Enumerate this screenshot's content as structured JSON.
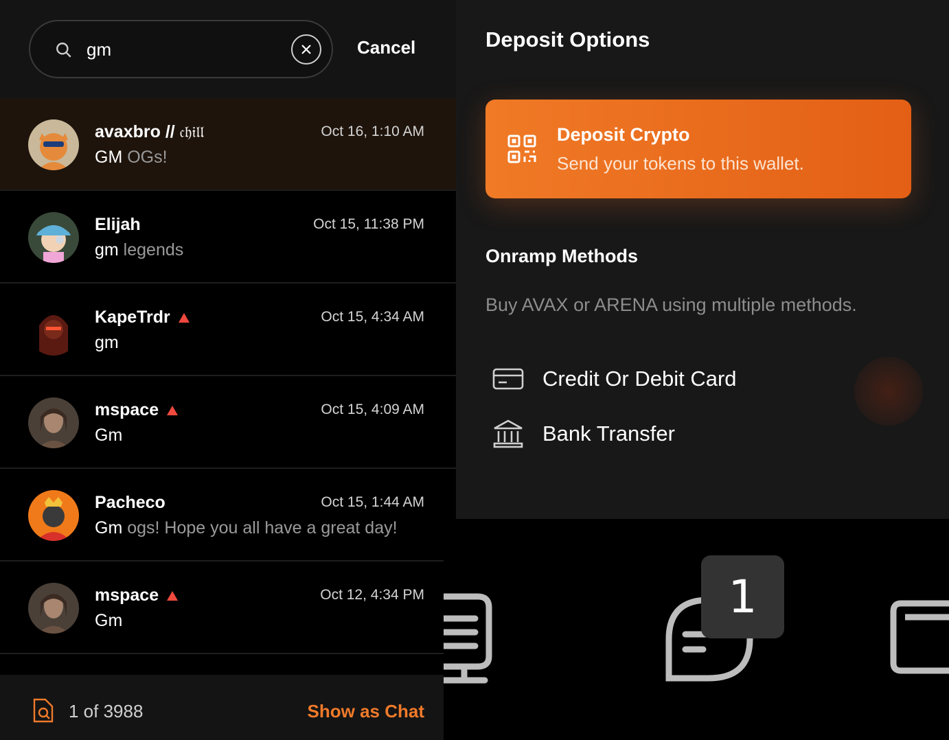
{
  "search": {
    "query": "gm",
    "cancel_label": "Cancel"
  },
  "results": [
    {
      "name": "avaxbro // ",
      "name_style": "𝔠𝔥𝔦𝔩𝔩",
      "time": "Oct 16, 1:10 AM",
      "msg_highlight": "GM",
      "msg_rest": " OGs!",
      "badge": false,
      "active": true
    },
    {
      "name": "Elijah",
      "time": "Oct 15, 11:38 PM",
      "msg_highlight": "gm",
      "msg_rest": " legends",
      "badge": false,
      "active": false
    },
    {
      "name": "KapeTrdr",
      "time": "Oct 15, 4:34 AM",
      "msg_highlight": "gm",
      "msg_rest": "",
      "badge": true,
      "active": false
    },
    {
      "name": "mspace",
      "time": "Oct 15, 4:09 AM",
      "msg_highlight": "Gm",
      "msg_rest": "",
      "badge": true,
      "active": false
    },
    {
      "name": "Pacheco",
      "time": "Oct 15, 1:44 AM",
      "msg_highlight": "Gm",
      "msg_rest": " ogs! Hope you all have a great day!",
      "badge": false,
      "active": false
    },
    {
      "name": "mspace",
      "time": "Oct 12, 4:34 PM",
      "msg_highlight": "Gm",
      "msg_rest": "",
      "badge": true,
      "active": false
    }
  ],
  "footer": {
    "count": "1 of 3988",
    "show_chat_label": "Show as Chat"
  },
  "deposit": {
    "title": "Deposit Options",
    "card_title": "Deposit Crypto",
    "card_subtitle": "Send your tokens to this wallet.",
    "onramp_title": "Onramp Methods",
    "onramp_subtitle": "Buy AVAX or ARENA using multiple methods.",
    "methods": [
      "Credit Or Debit Card",
      "Bank Transfer"
    ]
  },
  "nav": {
    "chat_badge": "1"
  },
  "colors": {
    "accent": "#f07a2a",
    "badge_red": "#f0493e",
    "active_row": "#1e140c"
  }
}
